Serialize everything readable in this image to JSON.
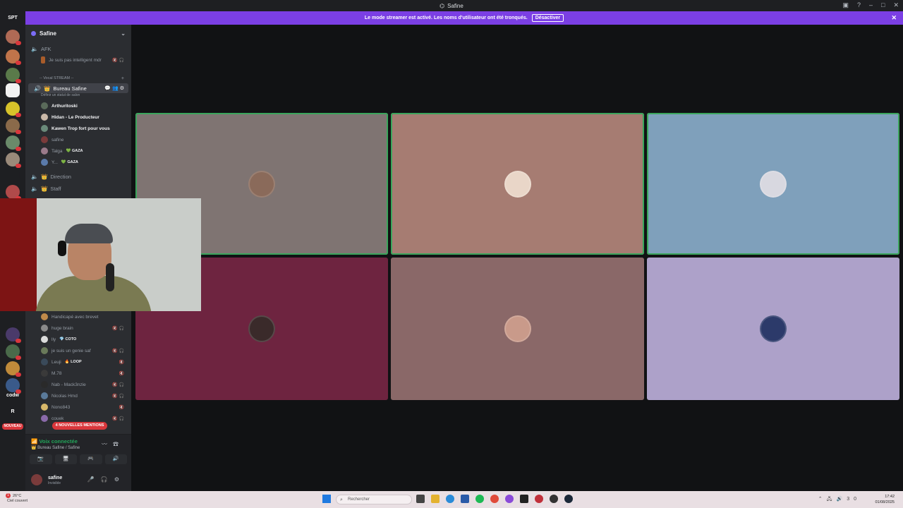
{
  "window": {
    "title": "Safine"
  },
  "banner": {
    "text": "Le mode streamer est activé. Les noms d'utilisateur ont été tronqués.",
    "button": "Désactiver"
  },
  "rail": {
    "top_badge": "SPT",
    "labels": [
      {
        "text": "codw"
      },
      {
        "text": "R"
      }
    ],
    "nouveau": "NOUVEAU"
  },
  "guild": {
    "name": "Safine"
  },
  "channels": {
    "afk": "AFK",
    "afk_user": "Je suis pas intelligent mdr",
    "category_stream": "-- Vocal STREAM --",
    "bureau": "Bureau Safine",
    "bureau_sub": "Définir un statut de salon",
    "bureau_users": [
      {
        "name": "Arthuritoski",
        "bold": true,
        "tag": ""
      },
      {
        "name": "Hidan - Le Producteur",
        "bold": true,
        "tag": ""
      },
      {
        "name": "Kawen Trop fort pour vous",
        "bold": true,
        "tag": ""
      },
      {
        "name": "safine",
        "bold": false,
        "tag": ""
      },
      {
        "name": "Talga",
        "bold": false,
        "tag": "GAZA"
      },
      {
        "name": "Y...",
        "bold": false,
        "tag": "GAZA"
      }
    ],
    "direction": "Direction",
    "staff": "Staff",
    "lower_users": [
      {
        "name": "Handicapé avec brevet",
        "tag": "",
        "icons": ""
      },
      {
        "name": "huge brain",
        "tag": "",
        "icons": "🔇🎧"
      },
      {
        "name": "lly",
        "tag": "COTO",
        "icons": ""
      },
      {
        "name": "je suis un genie saf",
        "tag": "",
        "icons": "🔇🎧"
      },
      {
        "name": "Leuji",
        "tag": "LOOP",
        "icons": "🔇"
      },
      {
        "name": "M.78",
        "tag": "",
        "icons": "🔇"
      },
      {
        "name": "Nab - Mack3nzie",
        "tag": "",
        "icons": "🔇🎧"
      },
      {
        "name": "Nicolas Hmd",
        "tag": "",
        "icons": "🔇🎧"
      },
      {
        "name": "Nono843",
        "tag": "",
        "icons": "🔇"
      },
      {
        "name": "couek",
        "tag": "",
        "icons": "🔇🎧"
      }
    ],
    "mentions": "4 NOUVELLES MENTIONS"
  },
  "voice": {
    "status": "Voix connectée",
    "location": "Bureau Safine / Safine"
  },
  "user_panel": {
    "name": "safine",
    "status": "Invisible"
  },
  "tiles": [
    {
      "color": "#7f7472",
      "speaking": true,
      "avatar": "#8a6a5a"
    },
    {
      "color": "#a67c72",
      "speaking": true,
      "avatar": "#e9d6c8"
    },
    {
      "color": "#7fa0bb",
      "speaking": true,
      "avatar": "#d8d8e0"
    },
    {
      "color": "#6e2440",
      "speaking": false,
      "avatar": "#3a2a2a"
    },
    {
      "color": "#8a6868",
      "speaking": false,
      "avatar": "#c99a8a"
    },
    {
      "color": "#ada1c9",
      "speaking": false,
      "avatar": "#2c3a6a"
    }
  ],
  "taskbar": {
    "weather_temp": "26°C",
    "weather_desc": "Ciel couvert",
    "weather_badge": "1",
    "search_placeholder": "Rechercher",
    "time": "17:42",
    "date": "01/08/2025",
    "tray_num": "30"
  }
}
